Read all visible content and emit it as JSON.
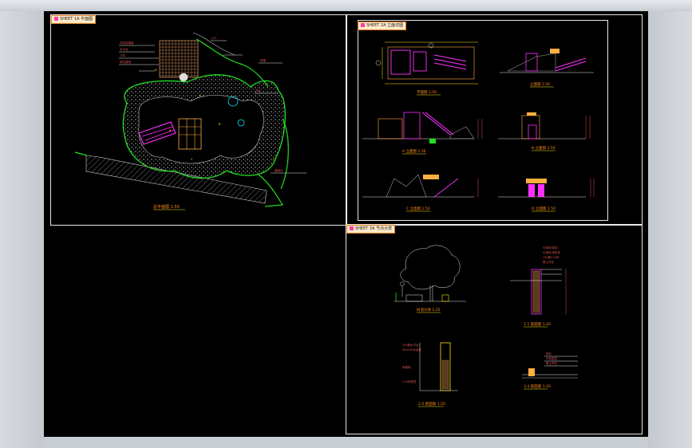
{
  "window": {
    "colors": {
      "background": "#000000",
      "frame": "#cfd3d8",
      "viewport_border": "#e8e8e8",
      "layer_green": "#22e022",
      "layer_magenta": "#ff30ff",
      "layer_yellow": "#ffe600",
      "layer_cyan": "#00e5ff",
      "layer_orange": "#ff8a1a",
      "layer_red": "#ff2020"
    }
  },
  "viewports": {
    "top_left": {
      "name_tag": "SHEET 1A  平面图",
      "drawing_title": "总平面图  1:50"
    },
    "top_right": {
      "name_tag": "SHEET 2A  立面详图",
      "titles": [
        "平面图  1:50",
        "立面图  1:50",
        "A 立面图  1:50",
        "B 立面图  1:50",
        "C 立面图  1:50",
        "D 立面图  1:50"
      ]
    },
    "bottom_right": {
      "name_tag": "SHEET 3A  节点大样",
      "titles": [
        "树池大样  1:20",
        "1-1 剖面图  1:20",
        "2-2 剖面图  1:20",
        "3-3 剖面图  1:20"
      ]
    }
  }
}
